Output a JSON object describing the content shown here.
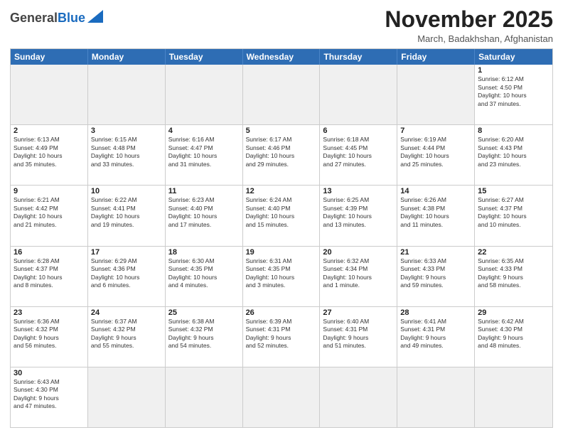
{
  "logo": {
    "general": "General",
    "blue": "Blue"
  },
  "title": "November 2025",
  "subtitle": "March, Badakhshan, Afghanistan",
  "days_of_week": [
    "Sunday",
    "Monday",
    "Tuesday",
    "Wednesday",
    "Thursday",
    "Friday",
    "Saturday"
  ],
  "weeks": [
    [
      {
        "day": "",
        "info": "",
        "empty": true
      },
      {
        "day": "",
        "info": "",
        "empty": true
      },
      {
        "day": "",
        "info": "",
        "empty": true
      },
      {
        "day": "",
        "info": "",
        "empty": true
      },
      {
        "day": "",
        "info": "",
        "empty": true
      },
      {
        "day": "",
        "info": "",
        "empty": true
      },
      {
        "day": "1",
        "info": "Sunrise: 6:12 AM\nSunset: 4:50 PM\nDaylight: 10 hours\nand 37 minutes."
      }
    ],
    [
      {
        "day": "2",
        "info": "Sunrise: 6:13 AM\nSunset: 4:49 PM\nDaylight: 10 hours\nand 35 minutes."
      },
      {
        "day": "3",
        "info": "Sunrise: 6:15 AM\nSunset: 4:48 PM\nDaylight: 10 hours\nand 33 minutes."
      },
      {
        "day": "4",
        "info": "Sunrise: 6:16 AM\nSunset: 4:47 PM\nDaylight: 10 hours\nand 31 minutes."
      },
      {
        "day": "5",
        "info": "Sunrise: 6:17 AM\nSunset: 4:46 PM\nDaylight: 10 hours\nand 29 minutes."
      },
      {
        "day": "6",
        "info": "Sunrise: 6:18 AM\nSunset: 4:45 PM\nDaylight: 10 hours\nand 27 minutes."
      },
      {
        "day": "7",
        "info": "Sunrise: 6:19 AM\nSunset: 4:44 PM\nDaylight: 10 hours\nand 25 minutes."
      },
      {
        "day": "8",
        "info": "Sunrise: 6:20 AM\nSunset: 4:43 PM\nDaylight: 10 hours\nand 23 minutes."
      }
    ],
    [
      {
        "day": "9",
        "info": "Sunrise: 6:21 AM\nSunset: 4:42 PM\nDaylight: 10 hours\nand 21 minutes."
      },
      {
        "day": "10",
        "info": "Sunrise: 6:22 AM\nSunset: 4:41 PM\nDaylight: 10 hours\nand 19 minutes."
      },
      {
        "day": "11",
        "info": "Sunrise: 6:23 AM\nSunset: 4:40 PM\nDaylight: 10 hours\nand 17 minutes."
      },
      {
        "day": "12",
        "info": "Sunrise: 6:24 AM\nSunset: 4:40 PM\nDaylight: 10 hours\nand 15 minutes."
      },
      {
        "day": "13",
        "info": "Sunrise: 6:25 AM\nSunset: 4:39 PM\nDaylight: 10 hours\nand 13 minutes."
      },
      {
        "day": "14",
        "info": "Sunrise: 6:26 AM\nSunset: 4:38 PM\nDaylight: 10 hours\nand 11 minutes."
      },
      {
        "day": "15",
        "info": "Sunrise: 6:27 AM\nSunset: 4:37 PM\nDaylight: 10 hours\nand 10 minutes."
      }
    ],
    [
      {
        "day": "16",
        "info": "Sunrise: 6:28 AM\nSunset: 4:37 PM\nDaylight: 10 hours\nand 8 minutes."
      },
      {
        "day": "17",
        "info": "Sunrise: 6:29 AM\nSunset: 4:36 PM\nDaylight: 10 hours\nand 6 minutes."
      },
      {
        "day": "18",
        "info": "Sunrise: 6:30 AM\nSunset: 4:35 PM\nDaylight: 10 hours\nand 4 minutes."
      },
      {
        "day": "19",
        "info": "Sunrise: 6:31 AM\nSunset: 4:35 PM\nDaylight: 10 hours\nand 3 minutes."
      },
      {
        "day": "20",
        "info": "Sunrise: 6:32 AM\nSunset: 4:34 PM\nDaylight: 10 hours\nand 1 minute."
      },
      {
        "day": "21",
        "info": "Sunrise: 6:33 AM\nSunset: 4:33 PM\nDaylight: 9 hours\nand 59 minutes."
      },
      {
        "day": "22",
        "info": "Sunrise: 6:35 AM\nSunset: 4:33 PM\nDaylight: 9 hours\nand 58 minutes."
      }
    ],
    [
      {
        "day": "23",
        "info": "Sunrise: 6:36 AM\nSunset: 4:32 PM\nDaylight: 9 hours\nand 56 minutes."
      },
      {
        "day": "24",
        "info": "Sunrise: 6:37 AM\nSunset: 4:32 PM\nDaylight: 9 hours\nand 55 minutes."
      },
      {
        "day": "25",
        "info": "Sunrise: 6:38 AM\nSunset: 4:32 PM\nDaylight: 9 hours\nand 54 minutes."
      },
      {
        "day": "26",
        "info": "Sunrise: 6:39 AM\nSunset: 4:31 PM\nDaylight: 9 hours\nand 52 minutes."
      },
      {
        "day": "27",
        "info": "Sunrise: 6:40 AM\nSunset: 4:31 PM\nDaylight: 9 hours\nand 51 minutes."
      },
      {
        "day": "28",
        "info": "Sunrise: 6:41 AM\nSunset: 4:31 PM\nDaylight: 9 hours\nand 49 minutes."
      },
      {
        "day": "29",
        "info": "Sunrise: 6:42 AM\nSunset: 4:30 PM\nDaylight: 9 hours\nand 48 minutes."
      }
    ],
    [
      {
        "day": "30",
        "info": "Sunrise: 6:43 AM\nSunset: 4:30 PM\nDaylight: 9 hours\nand 47 minutes."
      },
      {
        "day": "",
        "info": "",
        "empty": true
      },
      {
        "day": "",
        "info": "",
        "empty": true
      },
      {
        "day": "",
        "info": "",
        "empty": true
      },
      {
        "day": "",
        "info": "",
        "empty": true
      },
      {
        "day": "",
        "info": "",
        "empty": true
      },
      {
        "day": "",
        "info": "",
        "empty": true
      }
    ]
  ]
}
